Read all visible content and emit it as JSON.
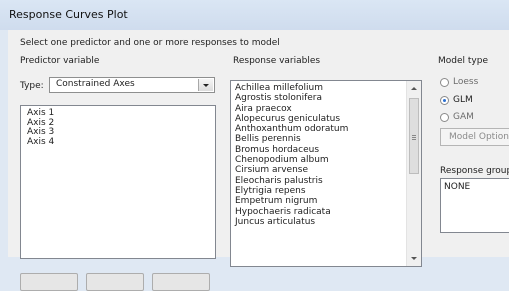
{
  "window": {
    "title": "Response Curves Plot"
  },
  "instruction": "Select one predictor and one or more responses to model",
  "predictor": {
    "title": "Predictor variable",
    "type_label": "Type:",
    "type_value": "Constrained Axes",
    "items": [
      "Axis 1",
      "Axis 2",
      "Axis 3",
      "Axis 4"
    ]
  },
  "response": {
    "title": "Response variables",
    "items": [
      "Achillea millefolium",
      "Agrostis stolonifera",
      "Aira praecox",
      "Alopecurus geniculatus",
      "Anthoxanthum odoratum",
      "Bellis perennis",
      "Bromus hordaceus",
      "Chenopodium album",
      "Cirsium arvense",
      "Eleocharis palustris",
      "Elytrigia repens",
      "Empetrum nigrum",
      "Hypochaeris radicata",
      "Juncus articulatus"
    ]
  },
  "model_type": {
    "title": "Model type",
    "options": [
      {
        "label": "Loess",
        "selected": false
      },
      {
        "label": "GLM",
        "selected": true
      },
      {
        "label": "GAM",
        "selected": false
      }
    ],
    "options_button": "Model Options"
  },
  "response_group": {
    "title": "Response group",
    "value": "NONE"
  },
  "colors": {
    "accent": "#2b6fd1",
    "title_bar": "#d4e1f1"
  }
}
